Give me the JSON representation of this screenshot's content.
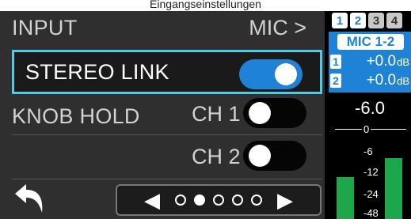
{
  "caption": "Eingangseinstellungen",
  "menu": {
    "input": {
      "label": "INPUT",
      "value": "MIC >"
    },
    "stereo_link": {
      "label": "STEREO LINK",
      "state": "on"
    },
    "knob_hold": {
      "label": "KNOB HOLD",
      "ch1_label": "CH 1",
      "ch1_state": "off",
      "ch2_label": "CH 2",
      "ch2_state": "off"
    }
  },
  "footer": {
    "back_icon": "back-arrow-icon",
    "pager_prev": "◀",
    "pager_next": "▶",
    "pages_total": 5,
    "page_active": 2
  },
  "meter": {
    "tabs": [
      "1",
      "2",
      "3",
      "4"
    ],
    "selected_tabs": [
      1,
      2
    ],
    "mic_label": "MIC 1-2",
    "gains": [
      {
        "ch": "1",
        "value": "+0.0",
        "unit": "dB"
      },
      {
        "ch": "2",
        "value": "+0.0",
        "unit": "dB"
      }
    ],
    "level": "-6.0",
    "scale": [
      "0",
      "-6",
      "-12",
      "-24",
      "-48"
    ],
    "bar_levels_db": [
      -15,
      -8
    ]
  },
  "colors": {
    "accent_blue": "#1e82d6",
    "highlight_border": "#55c7e8",
    "meter_green": "#1da64a",
    "panel_bg": "#2f2f2f"
  }
}
